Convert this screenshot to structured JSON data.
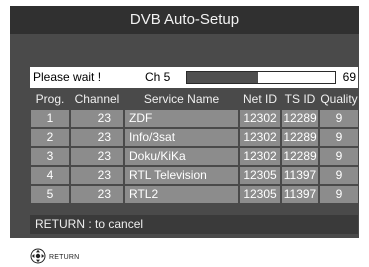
{
  "window": {
    "title": "DVB Auto-Setup"
  },
  "status": {
    "wait_text": "Please wait !",
    "channel_text": "Ch 5",
    "progress_value": "69",
    "progress_fraction": 0.48
  },
  "table": {
    "headers": {
      "prog": "Prog.",
      "channel": "Channel",
      "service": "Service Name",
      "net_id": "Net ID",
      "ts_id": "TS ID",
      "quality": "Quality"
    },
    "rows": [
      {
        "prog": "1",
        "channel": "23",
        "service": "ZDF",
        "net_id": "12302",
        "ts_id": "12289",
        "quality": "9"
      },
      {
        "prog": "2",
        "channel": "23",
        "service": "Info/3sat",
        "net_id": "12302",
        "ts_id": "12289",
        "quality": "9"
      },
      {
        "prog": "3",
        "channel": "23",
        "service": "Doku/KiKa",
        "net_id": "12302",
        "ts_id": "12289",
        "quality": "9"
      },
      {
        "prog": "4",
        "channel": "23",
        "service": "RTL Television",
        "net_id": "12305",
        "ts_id": "11397",
        "quality": "9"
      },
      {
        "prog": "5",
        "channel": "23",
        "service": "RTL2",
        "net_id": "12305",
        "ts_id": "11397",
        "quality": "9"
      }
    ]
  },
  "footer": {
    "message": "RETURN : to cancel"
  },
  "nav": {
    "label": "RETURN",
    "icon": "remote-dpad-icon"
  },
  "colors": {
    "screen": "#4a4a4a",
    "title_bar": "#303030",
    "row_bg": "#8c8c8c",
    "footer_bg": "#3a3a3a"
  }
}
